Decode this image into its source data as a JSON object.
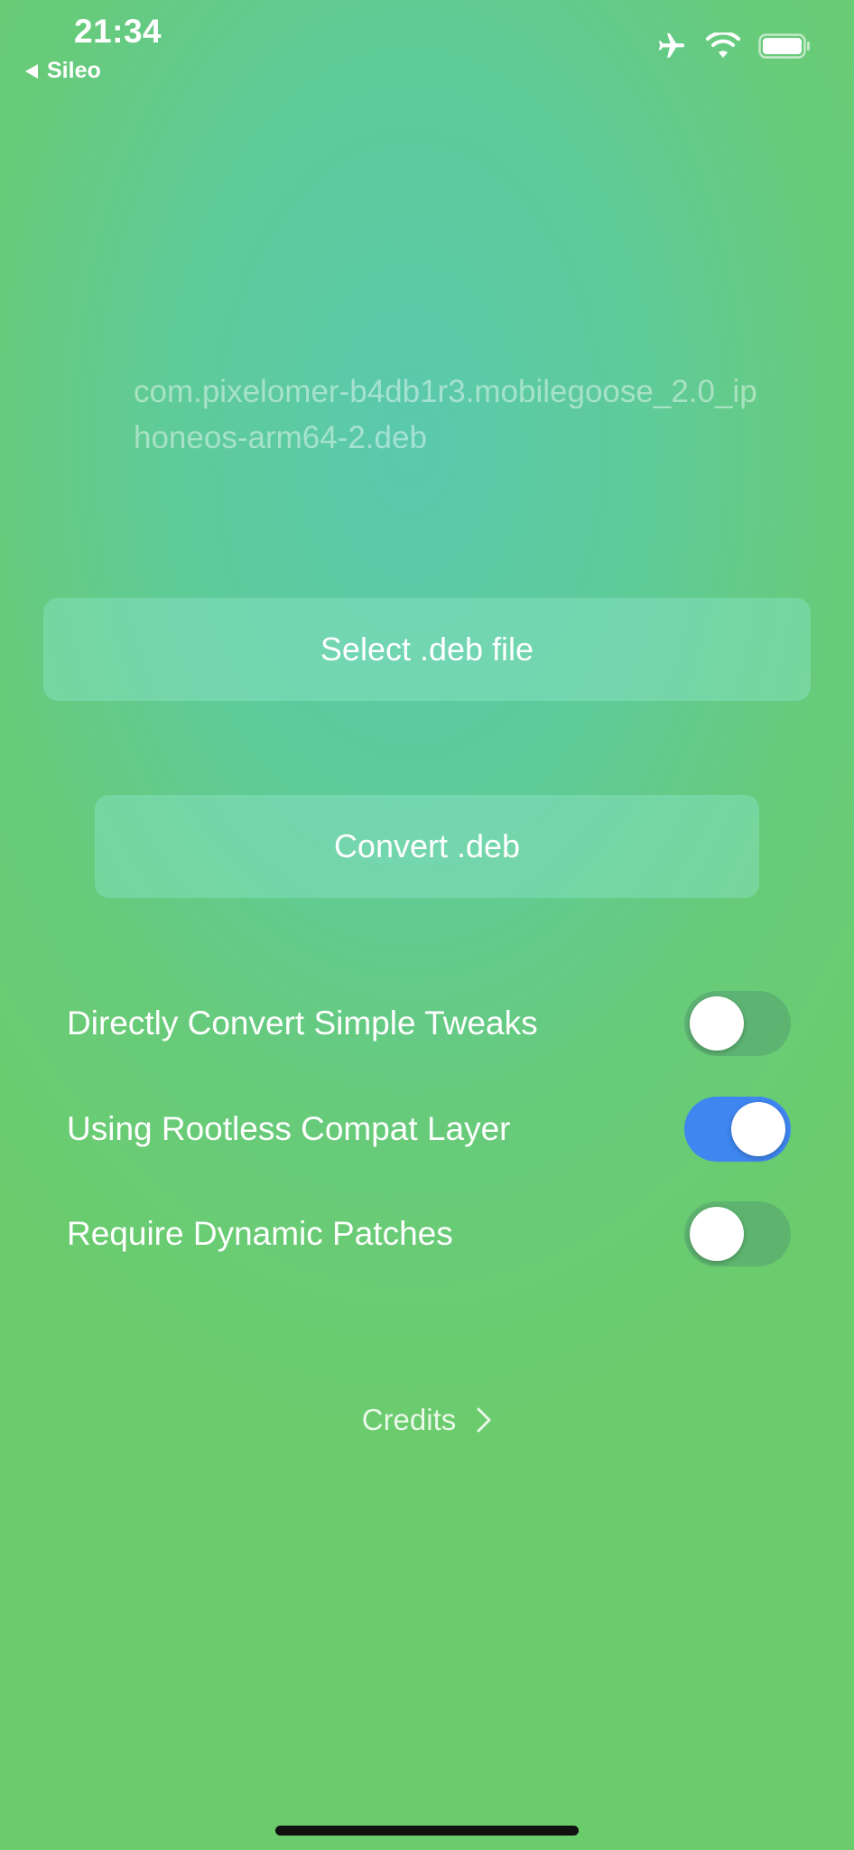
{
  "status_bar": {
    "time": "21:34",
    "back_app": "Sileo",
    "icons": [
      "airplane-icon",
      "wifi-icon",
      "battery-icon"
    ]
  },
  "main": {
    "selected_file": "com.pixelomer-b4db1r3.mobilegoose_2.0_iphoneos-arm64-2.deb",
    "select_button": "Select .deb file",
    "convert_button": "Convert .deb"
  },
  "options": [
    {
      "label": "Directly Convert Simple Tweaks",
      "on": false
    },
    {
      "label": "Using Rootless Compat Layer",
      "on": true
    },
    {
      "label": "Require Dynamic Patches",
      "on": false
    }
  ],
  "footer": {
    "credits": "Credits"
  },
  "colors": {
    "toggle_on": "#3f86f0",
    "background_top": "#5ac9ad",
    "background_bottom": "#6bcc6c"
  }
}
